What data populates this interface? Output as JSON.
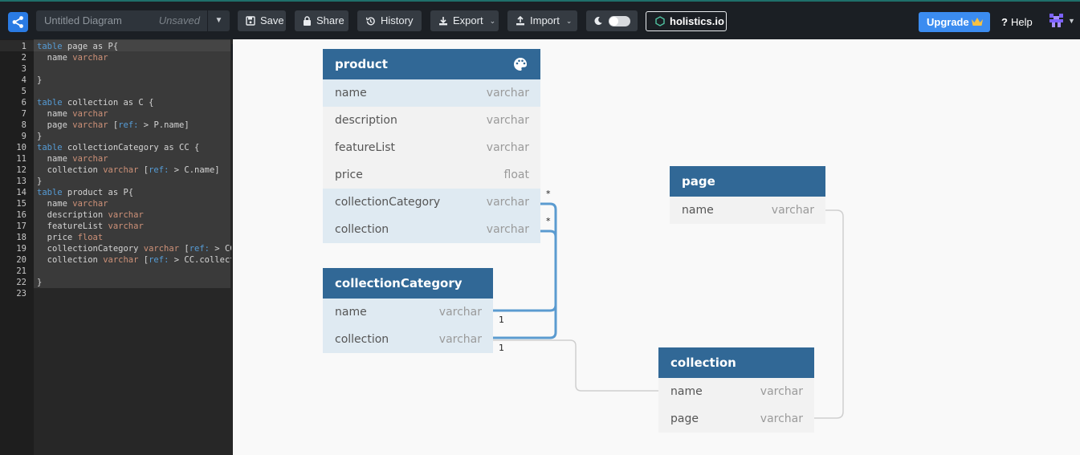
{
  "app": {
    "title_placeholder": "Untitled Diagram",
    "status": "Unsaved"
  },
  "toolbar": {
    "save_label": "Save",
    "share_label": "Share",
    "history_label": "History",
    "export_label": "Export",
    "import_label": "Import",
    "brand_label": "holistics.io",
    "upgrade_label": "Upgrade",
    "help_label": "Help"
  },
  "editor": {
    "line_numbers": [
      "1",
      "2",
      "3",
      "4",
      "5",
      "6",
      "7",
      "8",
      "9",
      "10",
      "11",
      "12",
      "13",
      "14",
      "15",
      "16",
      "17",
      "18",
      "19",
      "20",
      "21",
      "22",
      "23"
    ],
    "lines": [
      "table page as P{",
      "  name varchar",
      "",
      "}",
      "",
      "table collection as C {",
      "  name varchar",
      "  page varchar [ref: > P.name]",
      "}",
      "table collectionCategory as CC {",
      "  name varchar",
      "  collection varchar [ref: > C.name]",
      "}",
      "table product as P{",
      "  name varchar",
      "  description varchar",
      "  featureList varchar",
      "  price float",
      "  collectionCategory varchar [ref: > CC.name]",
      "  collection varchar [ref: > CC.collection]",
      "",
      "}"
    ]
  },
  "diagram": {
    "tables": {
      "product": {
        "name": "product",
        "fields": [
          {
            "name": "name",
            "type": "varchar"
          },
          {
            "name": "description",
            "type": "varchar"
          },
          {
            "name": "featureList",
            "type": "varchar"
          },
          {
            "name": "price",
            "type": "float"
          },
          {
            "name": "collectionCategory",
            "type": "varchar"
          },
          {
            "name": "collection",
            "type": "varchar"
          }
        ]
      },
      "collectionCategory": {
        "name": "collectionCategory",
        "fields": [
          {
            "name": "name",
            "type": "varchar"
          },
          {
            "name": "collection",
            "type": "varchar"
          }
        ]
      },
      "page": {
        "name": "page",
        "fields": [
          {
            "name": "name",
            "type": "varchar"
          }
        ]
      },
      "collection": {
        "name": "collection",
        "fields": [
          {
            "name": "name",
            "type": "varchar"
          },
          {
            "name": "page",
            "type": "varchar"
          }
        ]
      }
    },
    "relation_labels": {
      "many": "*",
      "one": "1"
    }
  },
  "colors": {
    "table_header": "#316896",
    "relation_highlight": "#5b9bd0",
    "relation_default": "#cfcfcf",
    "accent": "#3b8cf0"
  }
}
